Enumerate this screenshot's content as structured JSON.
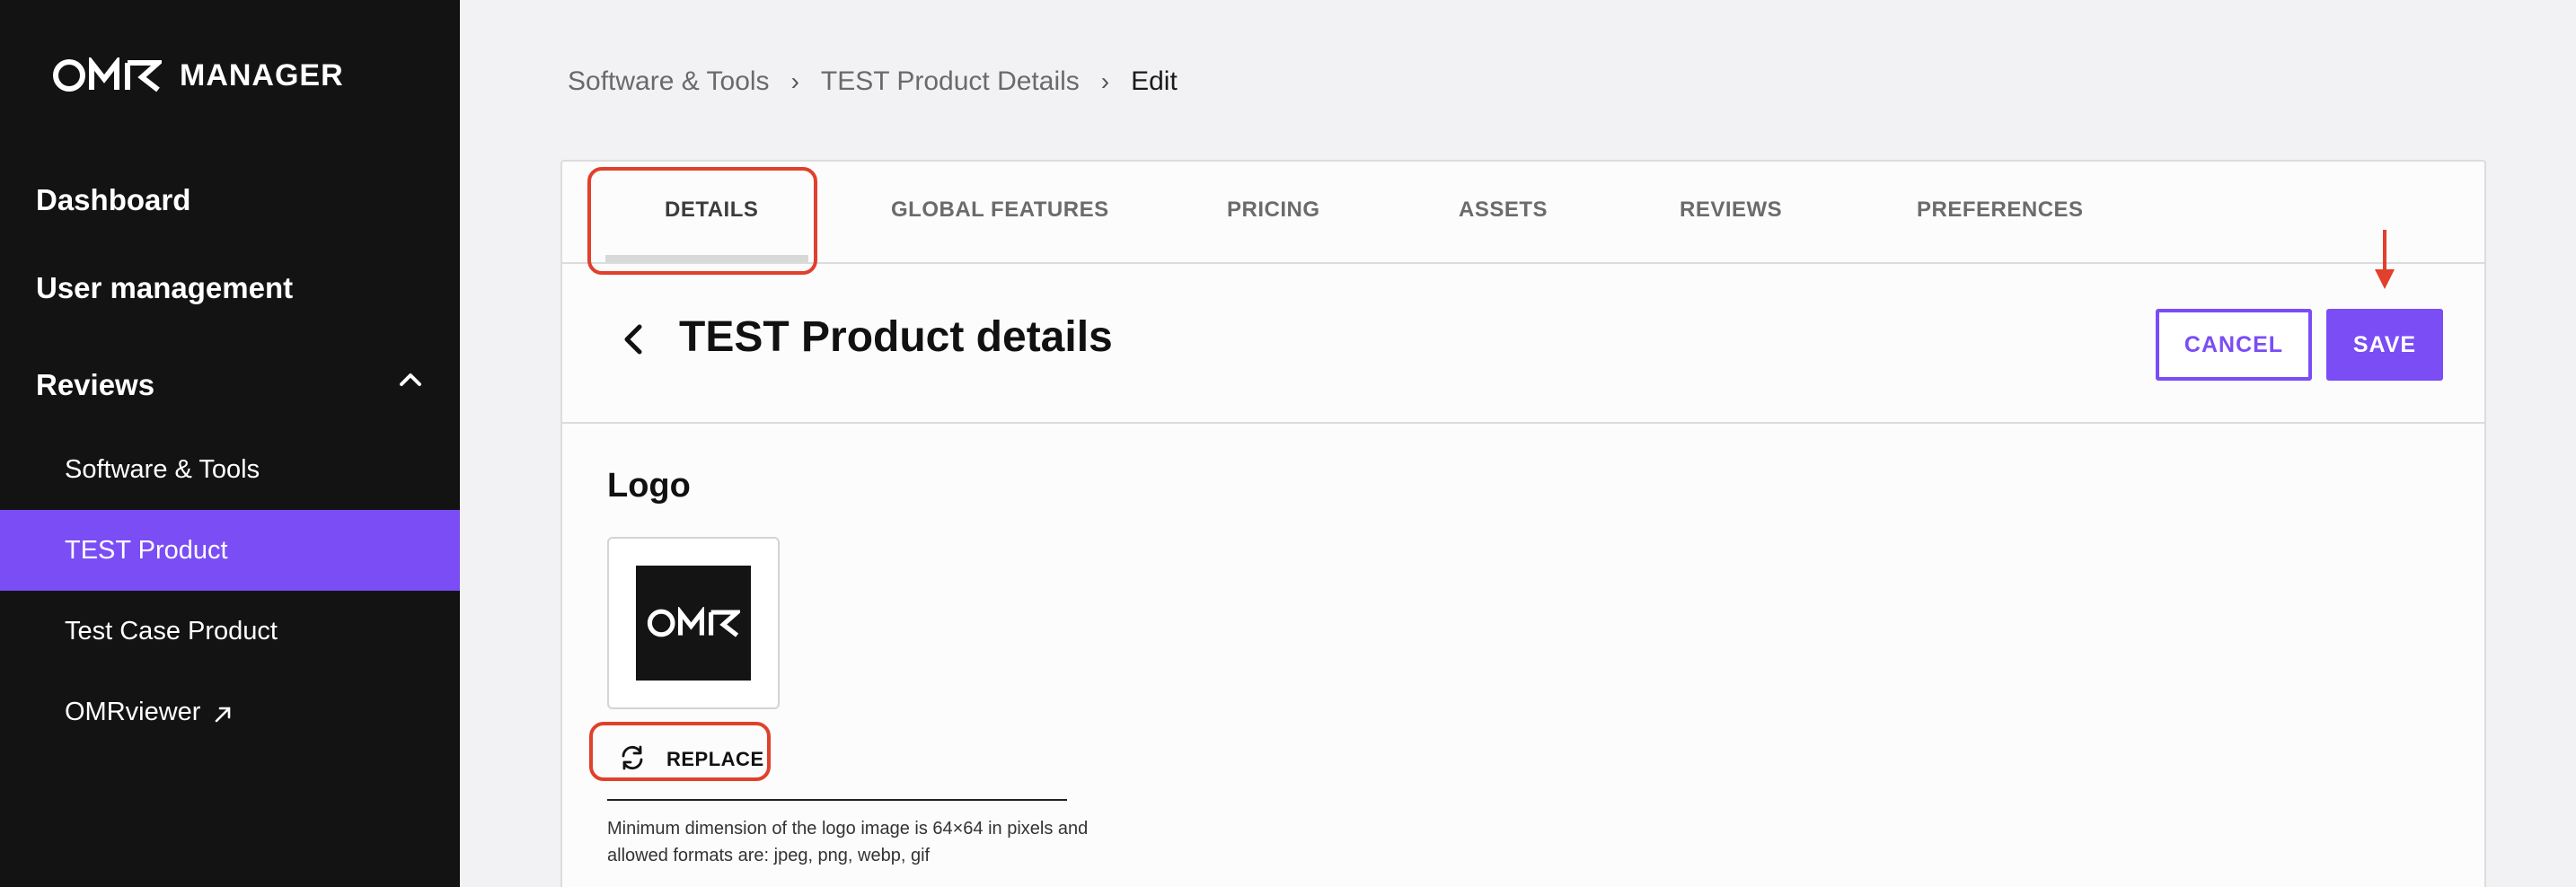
{
  "sidebar": {
    "brand": {
      "logo_text": "OMR",
      "name": "MANAGER"
    },
    "nav": [
      {
        "label": "Dashboard"
      },
      {
        "label": "User management"
      },
      {
        "label": "Reviews"
      }
    ],
    "sub_items": [
      {
        "label": "Software & Tools"
      },
      {
        "label": "TEST Product"
      },
      {
        "label": "Test Case Product"
      },
      {
        "label": "OMRviewer"
      }
    ]
  },
  "breadcrumb": {
    "items": [
      "Software & Tools",
      "TEST Product Details",
      "Edit"
    ],
    "separator": "›"
  },
  "tabs": [
    {
      "label": "DETAILS"
    },
    {
      "label": "GLOBAL FEATURES"
    },
    {
      "label": "PRICING"
    },
    {
      "label": "ASSETS"
    },
    {
      "label": "REVIEWS"
    },
    {
      "label": "PREFERENCES"
    }
  ],
  "header": {
    "title": "TEST Product details",
    "cancel_label": "CANCEL",
    "save_label": "SAVE"
  },
  "logo_section": {
    "title": "Logo",
    "logo_text": "OMR",
    "replace_label": "REPLACE",
    "hint": "Minimum dimension of the logo image is 64×64 in pixels and allowed formats are: jpeg, png, webp, gif"
  },
  "colors": {
    "accent": "#7a4df5",
    "sidebar_bg": "#131313",
    "annotation": "#e0402c"
  },
  "icons": {
    "back": "chevron-left-icon",
    "collapse": "chevron-up-icon",
    "external": "external-link-icon",
    "replace": "refresh-icon",
    "annotation": "arrow-down-icon"
  }
}
